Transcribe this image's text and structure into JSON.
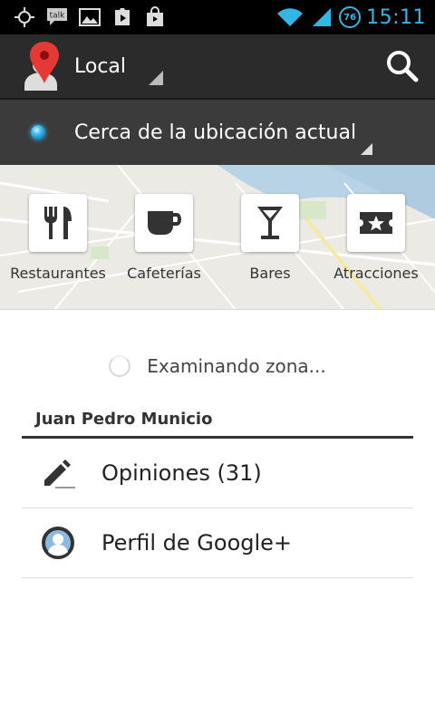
{
  "status_bar": {
    "left_icons": [
      "gps-icon",
      "talk-icon",
      "image-icon",
      "play-store-icon",
      "market-bag-icon"
    ],
    "talk_label": "talk",
    "battery": "76",
    "time": "15:11"
  },
  "action_bar": {
    "title": "Local"
  },
  "location": {
    "label": "Cerca de la ubicación actual"
  },
  "categories": [
    {
      "label": "Restaurantes",
      "icon": "fork-knife-icon"
    },
    {
      "label": "Cafeterías",
      "icon": "coffee-cup-icon"
    },
    {
      "label": "Bares",
      "icon": "cocktail-glass-icon"
    },
    {
      "label": "Atracciones",
      "icon": "ticket-star-icon"
    }
  ],
  "loading": {
    "text": "Examinando zona..."
  },
  "user": {
    "name": "Juan Pedro Municio",
    "items": [
      {
        "label": "Opiniones (31)",
        "icon": "pencil-icon"
      },
      {
        "label": "Perfil de Google+",
        "icon": "profile-icon"
      }
    ]
  },
  "colors": {
    "accent": "#33b5e5",
    "action_bar": "#2b2b2b",
    "location_bar": "#3b3b3b",
    "map_bg": "#eceae4"
  }
}
